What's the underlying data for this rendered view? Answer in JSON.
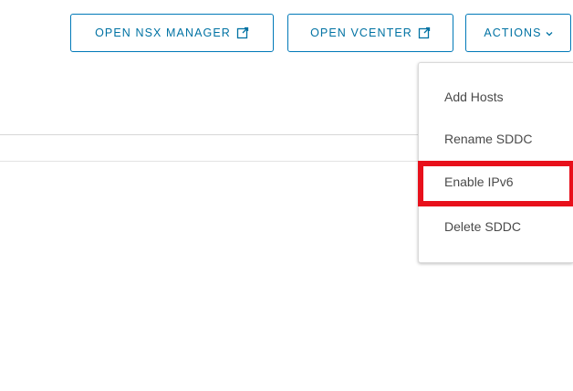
{
  "toolbar": {
    "open_nsx_label": "OPEN NSX MANAGER",
    "open_vcenter_label": "OPEN VCENTER",
    "actions_label": "ACTIONS"
  },
  "icons": {
    "external_link": "external-link-icon",
    "chevron": "chevron-down-icon"
  },
  "actions_menu": {
    "items": [
      {
        "label": "Add Hosts"
      },
      {
        "label": "Rename SDDC"
      },
      {
        "label": "Enable IPv6"
      },
      {
        "label": "Delete SDDC"
      }
    ],
    "highlighted_index": 2
  },
  "colors": {
    "accent": "#0072a3",
    "highlight": "#e8101b",
    "menu_text": "#4a4a4a"
  }
}
